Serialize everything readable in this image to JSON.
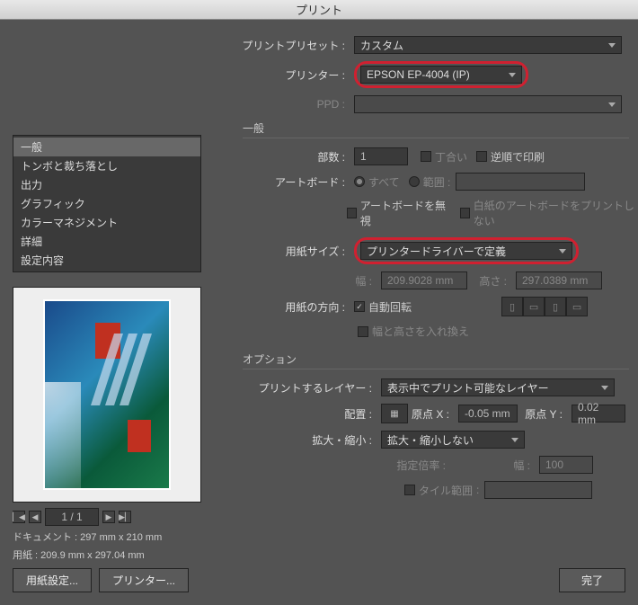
{
  "title": "プリント",
  "header": {
    "preset_label": "プリントプリセット",
    "preset_value": "カスタム",
    "printer_label": "プリンター",
    "printer_value": "EPSON EP-4004 (IP)",
    "ppd_label": "PPD"
  },
  "sidebar": {
    "items": [
      {
        "label": "一般"
      },
      {
        "label": "トンボと裁ち落とし"
      },
      {
        "label": "出力"
      },
      {
        "label": "グラフィック"
      },
      {
        "label": "カラーマネジメント"
      },
      {
        "label": "詳細"
      },
      {
        "label": "設定内容"
      }
    ]
  },
  "general": {
    "title": "一般",
    "copies_label": "部数",
    "copies_value": "1",
    "collate_label": "丁合い",
    "reverse_label": "逆順で印刷",
    "artboard_label": "アートボード",
    "all_label": "すべて",
    "range_label": "範囲",
    "ignore_label": "アートボードを無視",
    "blank_label": "白紙のアートボードをプリントしない",
    "papersize_label": "用紙サイズ",
    "papersize_value": "プリンタードライバーで定義",
    "width_label": "幅",
    "width_value": "209.9028 mm",
    "height_label": "高さ",
    "height_value": "297.0389 mm",
    "orient_label": "用紙の方向",
    "autorotate_label": "自動回転",
    "swap_label": "幅と高さを入れ換え"
  },
  "options": {
    "title": "オプション",
    "layers_label": "プリントするレイヤー",
    "layers_value": "表示中でプリント可能なレイヤー",
    "placement_label": "配置",
    "originx_label": "原点 X",
    "originx_value": "-0.05 mm",
    "originy_label": "原点 Y",
    "originy_value": "0.02 mm",
    "scale_label": "拡大・縮小",
    "scale_value": "拡大・縮小しない",
    "ratio_label": "指定倍率",
    "scale_width_label": "幅",
    "scale_width_value": "100",
    "tile_label": "タイル範囲"
  },
  "preview": {
    "page_current": "1 / 1",
    "doc_label": "ドキュメント",
    "doc_value": "297 mm x 210 mm",
    "paper_label": "用紙",
    "paper_value": "209.9 mm x 297.04 mm"
  },
  "footer": {
    "page_setup": "用紙設定...",
    "printer": "プリンター...",
    "done": "完了"
  }
}
